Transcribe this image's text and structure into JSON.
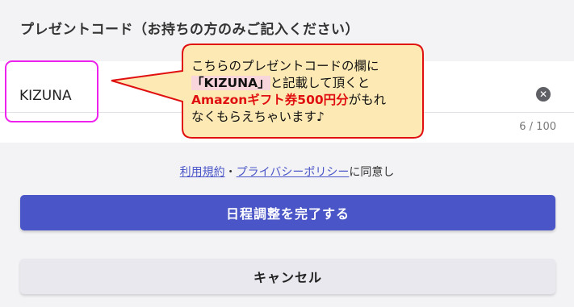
{
  "section_title": "プレゼントコード（お持ちの方のみご記入ください）",
  "code_input": {
    "value": "KIZUNA",
    "char_count": "6 / 100"
  },
  "annotation": {
    "line1": "こちらのプレゼントコードの欄に",
    "code_label": "「KIZUNA」",
    "line2_rest": "と記載して頂くと",
    "offer": "Amazonギフト券500円分",
    "line3_rest": "がもれ",
    "line4": "なくもらえちゃいます♪"
  },
  "agreement": {
    "terms_link": "利用規約",
    "separator": "・",
    "privacy_link": "プライバシーポリシー",
    "suffix": "に同意し"
  },
  "buttons": {
    "submit_label": "日程調整を完了する",
    "cancel_label": "キャンセル"
  },
  "colors": {
    "primary": "#4a55c7",
    "highlight_border": "#ee22ee",
    "callout_fill": "#fde9b4",
    "callout_border": "#e01010",
    "offer_text": "#e01010"
  }
}
